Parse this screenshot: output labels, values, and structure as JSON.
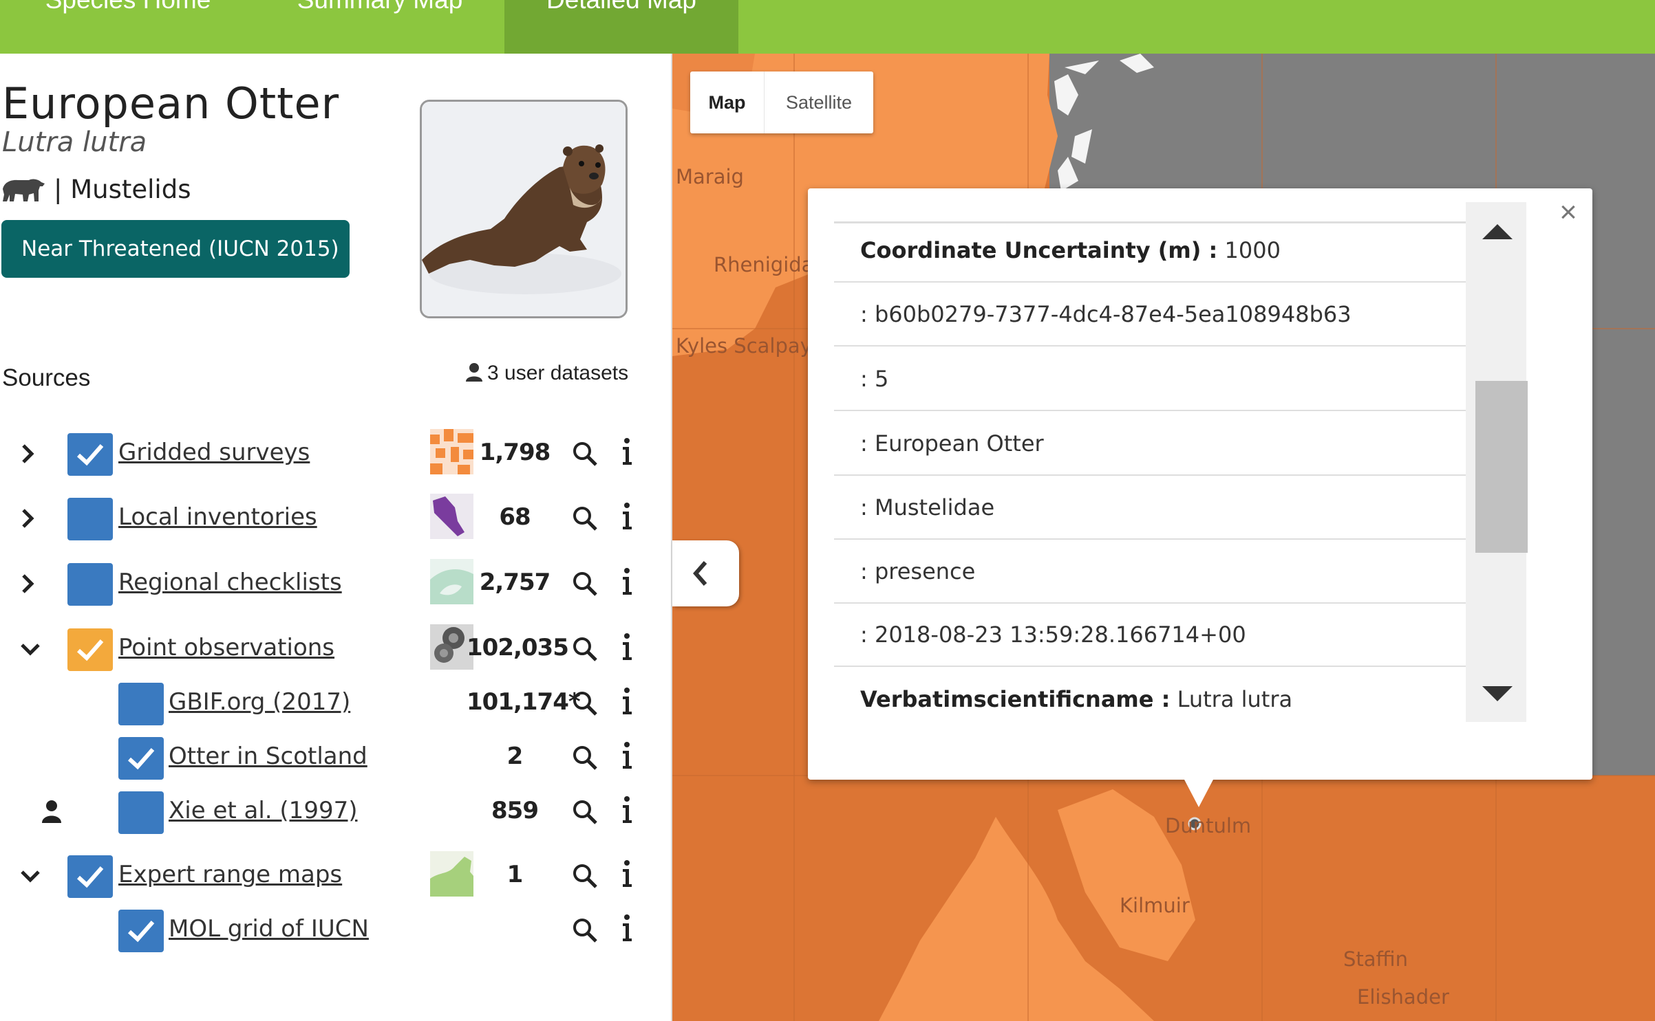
{
  "nav": {
    "tabs": [
      {
        "label": "Species Home"
      },
      {
        "label": "Summary Map"
      },
      {
        "label": "Detailed Map",
        "active": true
      }
    ]
  },
  "species": {
    "common_name": "European Otter",
    "scientific_name": "Lutra lutra",
    "group_separator": "|",
    "group": "Mustelids",
    "group_icon": "bear-icon",
    "status": "Near Threatened (IUCN 2015)",
    "photo": "otter-photo"
  },
  "sources": {
    "title": "Sources",
    "user_datasets": "3 user datasets",
    "rows": [
      {
        "label": "Gridded surveys",
        "count": "1,798",
        "checked": true,
        "expand": "collapsed"
      },
      {
        "label": "Local inventories",
        "count": "68",
        "checked": false,
        "expand": "collapsed"
      },
      {
        "label": "Regional checklists",
        "count": "2,757",
        "checked": false,
        "expand": "collapsed"
      },
      {
        "label": "Point observations",
        "count": "102,035",
        "checked": true,
        "expand": "expanded"
      },
      {
        "label": "GBIF.org (2017)",
        "count": "101,174*",
        "checked": false
      },
      {
        "label": "Otter in Scotland",
        "count": "2",
        "checked": true
      },
      {
        "label": "Xie et al. (1997)",
        "count": "859",
        "checked": false,
        "user": true
      },
      {
        "label": "Expert range maps",
        "count": "1",
        "checked": true,
        "expand": "expanded"
      },
      {
        "label": "MOL grid of IUCN",
        "count": "",
        "checked": true
      }
    ]
  },
  "map": {
    "type_buttons": [
      "Map",
      "Satellite"
    ],
    "labels": [
      "Maraig",
      "Rhenigidale",
      "Kyles Scalpay",
      "Duntulm",
      "Kilmuir",
      "Staffin",
      "Elishader"
    ],
    "popup": {
      "rows": [
        {
          "key": "Coordinate Uncertainty (m) :",
          "value": "1000"
        },
        {
          "key": "",
          "value": ": b60b0279-7377-4dc4-87e4-5ea108948b63"
        },
        {
          "key": "",
          "value": ": 5"
        },
        {
          "key": "",
          "value": ": European Otter"
        },
        {
          "key": "",
          "value": ": Mustelidae"
        },
        {
          "key": "",
          "value": ": presence"
        },
        {
          "key": "",
          "value": ": 2018-08-23 13:59:28.166714+00"
        },
        {
          "key": "Verbatimscientificname :",
          "value": "Lutra lutra"
        }
      ],
      "close": "×"
    },
    "colors": {
      "land_light": "#f5954f",
      "land_dark": "#dc7534",
      "water": "#7f7f7f"
    }
  }
}
